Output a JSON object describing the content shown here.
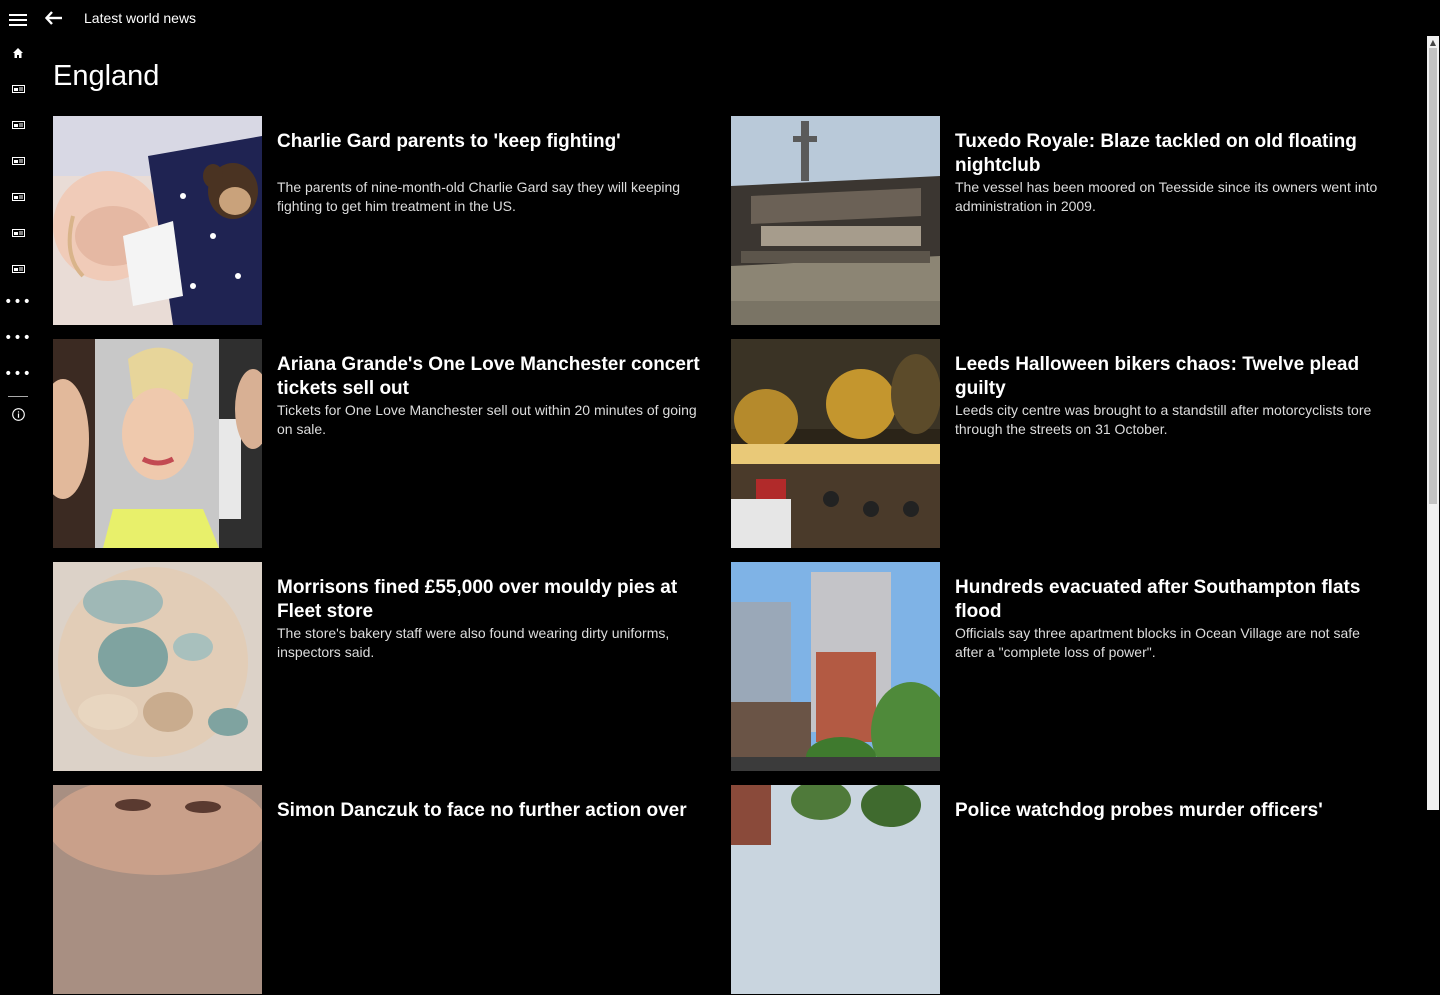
{
  "app": {
    "title": "Latest world news"
  },
  "section": {
    "title": "England"
  },
  "rail": {
    "items": [
      {
        "icon": "home-icon"
      },
      {
        "icon": "news-icon"
      },
      {
        "icon": "news-icon"
      },
      {
        "icon": "news-icon"
      },
      {
        "icon": "news-icon"
      },
      {
        "icon": "news-icon"
      },
      {
        "icon": "news-icon"
      },
      {
        "icon": "more-icon"
      },
      {
        "icon": "more-icon"
      },
      {
        "icon": "more-icon"
      },
      {
        "icon": "info-icon"
      }
    ]
  },
  "articles": [
    {
      "title": "Charlie Gard parents to 'keep fighting'",
      "description": "The parents of nine-month-old Charlie Gard say they will keeping fighting to get him treatment in the US."
    },
    {
      "title": "Tuxedo Royale: Blaze tackled on old floating nightclub",
      "description": "The vessel has been moored on Teesside since its owners went into administration in 2009."
    },
    {
      "title": "Ariana Grande's One Love Manchester concert tickets sell out",
      "description": "Tickets for One Love Manchester sell out within 20 minutes of going on sale."
    },
    {
      "title": "Leeds Halloween bikers chaos: Twelve plead guilty",
      "description": "Leeds city centre was brought to a standstill after motorcyclists tore through the streets on 31 October."
    },
    {
      "title": "Morrisons fined £55,000 over mouldy pies at Fleet store",
      "description": "The store's bakery staff were also found wearing dirty uniforms, inspectors said."
    },
    {
      "title": "Hundreds evacuated after Southampton flats flood",
      "description": "Officials say three apartment blocks in Ocean Village are not safe after a \"complete loss of power\"."
    },
    {
      "title": "Simon Danczuk to face no further action over",
      "description": ""
    },
    {
      "title": "Police watchdog probes murder officers'",
      "description": ""
    }
  ],
  "colors": {
    "background": "#000000",
    "text": "#ffffff",
    "scrollbar": "#f0f0f0"
  }
}
